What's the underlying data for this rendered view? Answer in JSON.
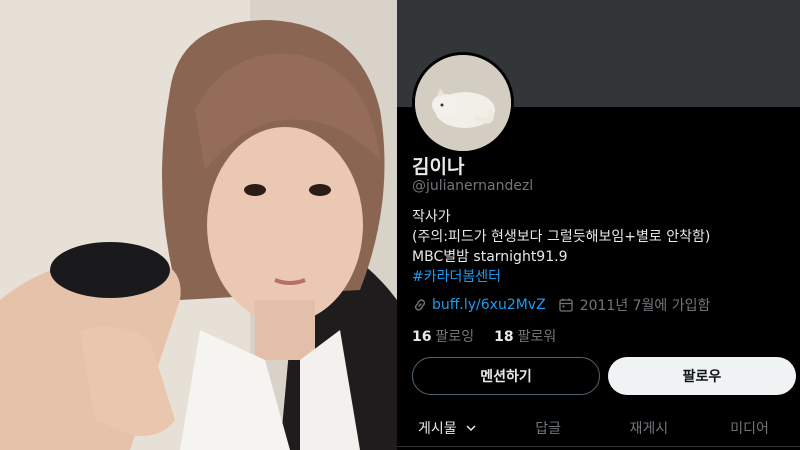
{
  "profile": {
    "display_name": "김이나",
    "handle": "@julianernandezl",
    "bio_lines": [
      "작사가",
      "(주의:피드가 현생보다 그럴듯해보임+별로 안착함)",
      "MBC별밤 starnight91.9"
    ],
    "hashtag": "#카라더봄센터",
    "link_text": "buff.ly/6xu2MvZ",
    "joined": "2011년 7월에 가입함",
    "following_count": "16",
    "following_label": "팔로잉",
    "followers_count": "18",
    "followers_label": "팔로워"
  },
  "buttons": {
    "mention": "멘션하기",
    "follow": "팔로우"
  },
  "tabs": [
    {
      "label": "게시물",
      "active": true
    },
    {
      "label": "답글",
      "active": false
    },
    {
      "label": "재게시",
      "active": false
    },
    {
      "label": "미디어",
      "active": false
    }
  ],
  "icons": {
    "link": "link-icon",
    "calendar": "calendar-icon",
    "tab_dropdown": "chevron-down-icon"
  },
  "colors": {
    "accent": "#1d9bf0",
    "background": "#000000",
    "banner": "#333639",
    "text_primary": "#e7e9ea",
    "text_secondary": "#71767b"
  }
}
